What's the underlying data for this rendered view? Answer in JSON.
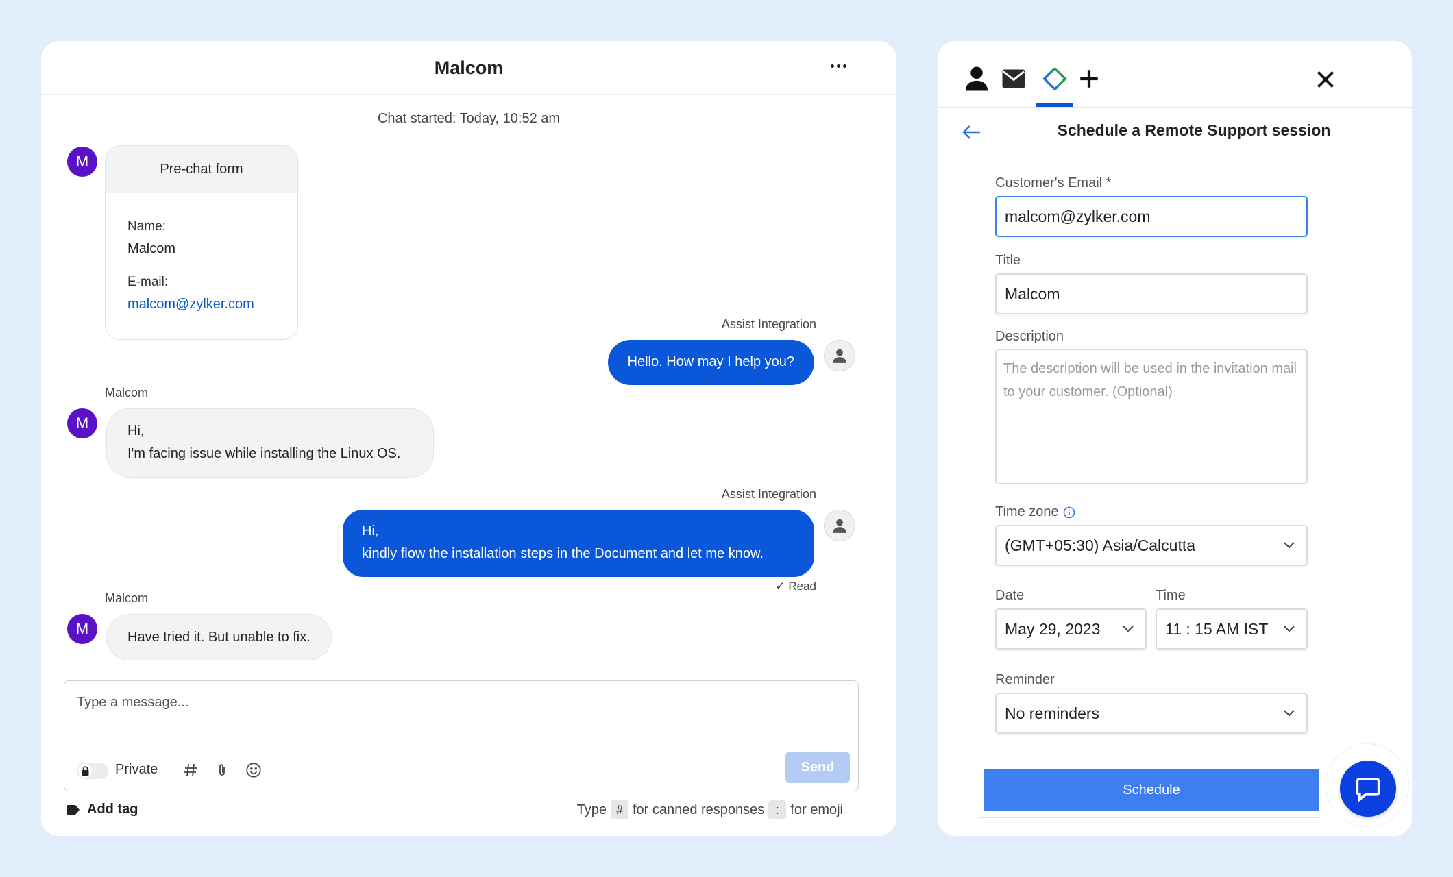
{
  "chat": {
    "title": "Malcom",
    "started": "Chat started: Today, 10:52 am",
    "avatar_letter": "M",
    "prechat": {
      "title": "Pre-chat form",
      "name_label": "Name:",
      "name_value": "Malcom",
      "email_label": "E-mail:",
      "email_value": "malcom@zylker.com"
    },
    "messages": [
      {
        "sender": "Assist Integration",
        "text": "Hello. How may I help you?"
      },
      {
        "sender": "Malcom",
        "line1": "Hi,",
        "line2": "I'm facing issue while installing the Linux OS."
      },
      {
        "sender": "Assist Integration",
        "line1": "Hi,",
        "line2": "kindly flow the installation steps in the Document and let me know.",
        "status": "✓ Read"
      },
      {
        "sender": "Malcom",
        "text": "Have tried it. But unable to fix."
      }
    ],
    "composer": {
      "placeholder": "Type a message...",
      "private_label": "Private",
      "send_label": "Send"
    },
    "add_tag_label": "Add tag",
    "hint": {
      "type_label": "Type",
      "hash_key": "#",
      "canned_label": "for canned responses",
      "colon_key": ":",
      "emoji_label": "for emoji"
    }
  },
  "panel": {
    "tabs": [
      "person-icon",
      "mail-icon",
      "assist-icon",
      "plus-icon"
    ],
    "active_tab": "assist-icon",
    "title": "Schedule a Remote Support session",
    "form": {
      "email_label": "Customer's Email *",
      "email_value": "malcom@zylker.com",
      "title_label": "Title",
      "title_value": "Malcom",
      "description_label": "Description",
      "description_placeholder": "The description will be used in the invitation mail to your customer. (Optional)",
      "timezone_label": "Time zone",
      "timezone_value": "(GMT+05:30) Asia/Calcutta",
      "date_label": "Date",
      "date_value": "May 29, 2023",
      "time_label": "Time",
      "time_value": "11 : 15 AM IST",
      "reminder_label": "Reminder",
      "reminder_value": "No reminders"
    },
    "schedule_label": "Schedule"
  },
  "colors": {
    "accent": "#0b57d9",
    "avatar": "#5a12c8",
    "schedule_button": "#3f7ef0",
    "assist_icon": "#1aa34a"
  }
}
